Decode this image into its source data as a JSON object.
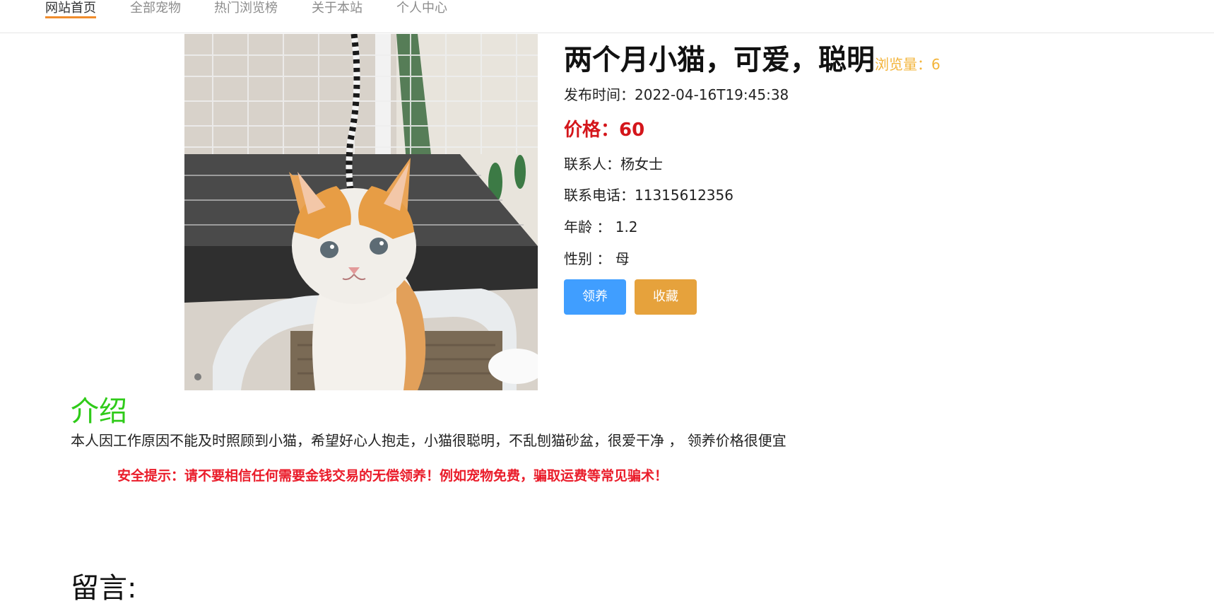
{
  "nav": {
    "items": [
      {
        "label": "网站首页",
        "active": true
      },
      {
        "label": "全部宠物",
        "active": false
      },
      {
        "label": "热门浏览榜",
        "active": false
      },
      {
        "label": "关于本站",
        "active": false
      },
      {
        "label": "个人中心",
        "active": false
      }
    ],
    "active_underline_color": "#f08c2c"
  },
  "pet": {
    "title": "两个月小猫，可爱，聪明",
    "views_label": "浏览量：6",
    "publish_time": "发布时间：2022-04-16T19:45:38",
    "price": "价格：60",
    "contact": "联系人：杨女士",
    "phone": "联系电话：11315612356",
    "age": "年龄 ： 1.2",
    "gender": "性别 ： 母",
    "photo_alt": "cat-photo"
  },
  "actions": {
    "adopt_label": "领养",
    "favorite_label": "收藏",
    "adopt_color": "#409eff",
    "favorite_color": "#e6a23c"
  },
  "intro": {
    "heading": "介绍",
    "text": "本人因工作原因不能及时照顾到小猫，希望好心人抱走，小猫很聪明，不乱刨猫砂盆，很爱干净 ， 领养价格很便宜",
    "warning": "安全提示：请不要相信任何需要金钱交易的无偿领养！例如宠物免费，骗取运费等常见骗术！"
  },
  "comments": {
    "heading": "留言:"
  },
  "colors": {
    "intro_heading": "#2fcb19",
    "warning": "#ea1c2a",
    "price": "#d4161b",
    "views": "#f3b43a"
  }
}
